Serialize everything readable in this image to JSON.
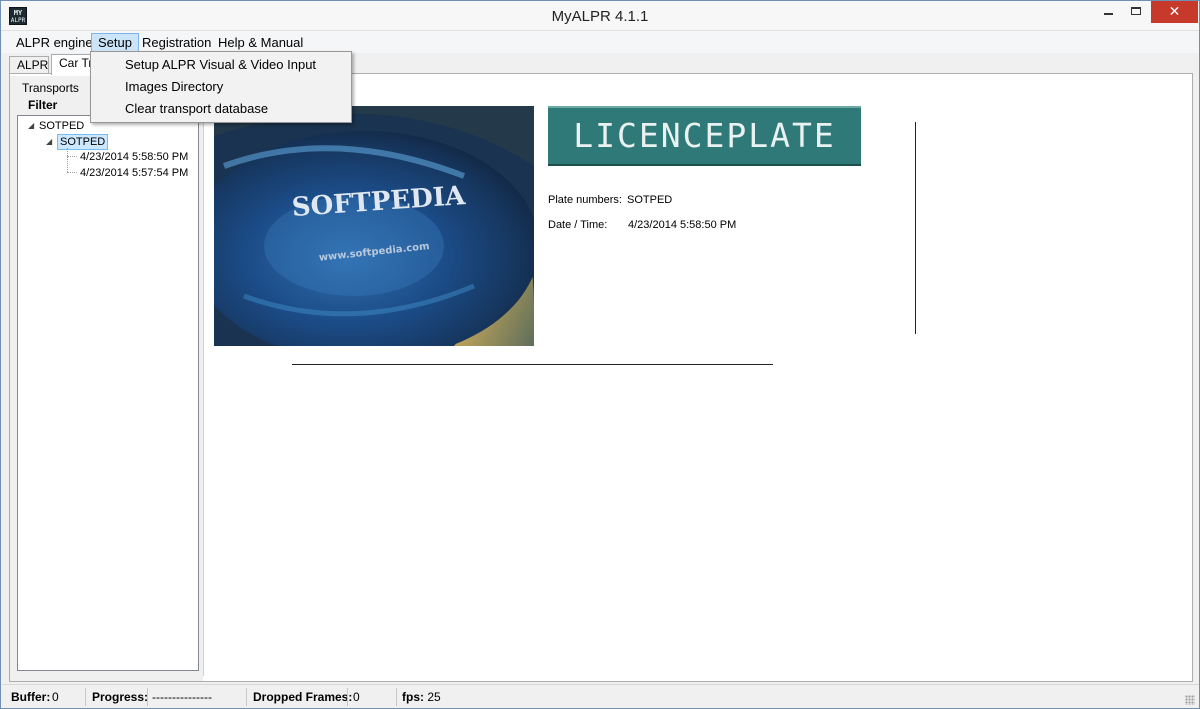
{
  "window": {
    "title": "MyALPR 4.1.1",
    "icon_text_top": "MY",
    "icon_text_bottom": "ALPR",
    "minimize_icon": "minimize-icon",
    "maximize_icon": "maximize-icon",
    "close_glyph": "✕"
  },
  "menubar": {
    "items": [
      {
        "label": "ALPR engine"
      },
      {
        "label": "Setup"
      },
      {
        "label": "Registration"
      },
      {
        "label": "Help & Manual"
      }
    ]
  },
  "setup_menu": {
    "items": [
      {
        "label": "Setup ALPR Visual & Video Input"
      },
      {
        "label": "Images Directory"
      },
      {
        "label": "Clear transport database"
      }
    ]
  },
  "tabs": [
    {
      "label": "ALPR"
    },
    {
      "label": "Car Tr"
    }
  ],
  "left_panel": {
    "title": "Transports",
    "filter_label": "Filter",
    "tree": {
      "root": "SOTPED",
      "child": "SOTPED",
      "entries": [
        "4/23/2014 5:58:50 PM",
        "4/23/2014 5:57:54 PM"
      ]
    }
  },
  "detail": {
    "vehicle_image_text": "SOFTPEDIA",
    "vehicle_image_subtext": "www.softpedia.com",
    "plate_image_text": "LICENCEPLATE",
    "plate_numbers_label": "Plate numbers:",
    "plate_numbers_value": "SOTPED",
    "datetime_label": "Date / Time:",
    "datetime_value": "4/23/2014 5:58:50 PM"
  },
  "statusbar": {
    "buffer_label": "Buffer:",
    "buffer_value": "0",
    "progress_label": "Progress:",
    "progress_value": "---------------",
    "dropped_label": "Dropped Frames:",
    "dropped_value": "0",
    "fps_label": "fps:",
    "fps_value": "25"
  },
  "colors": {
    "menu_highlight": "#cce4f7",
    "plate_background": "#2f7a78",
    "close_button": "#c7392a"
  }
}
